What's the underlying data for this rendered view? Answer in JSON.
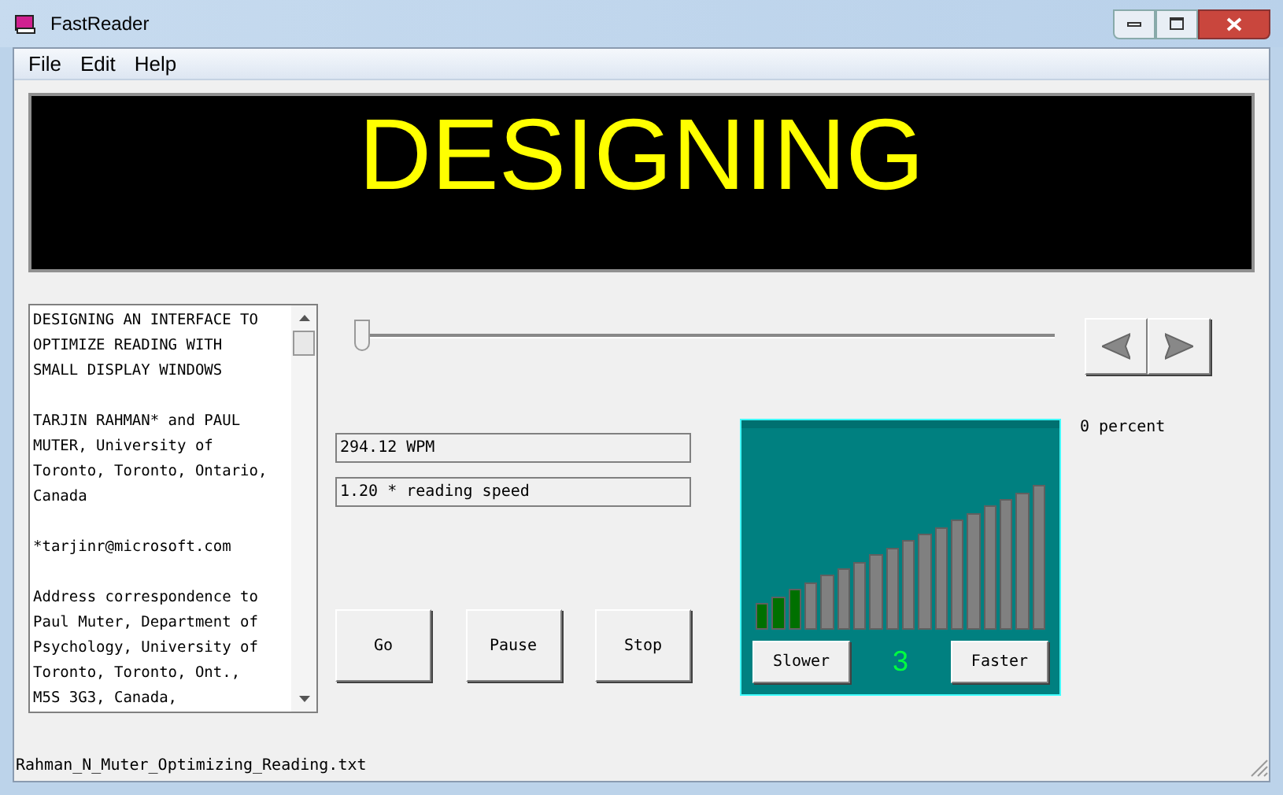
{
  "window": {
    "title": "FastReader"
  },
  "menu": [
    "File",
    "Edit",
    "Help"
  ],
  "display": {
    "word": "DESIGNING"
  },
  "document": {
    "paragraphs": [
      [
        "DESIGNING AN INTERFACE TO",
        "OPTIMIZE READING WITH",
        "SMALL DISPLAY WINDOWS"
      ],
      [
        "TARJIN RAHMAN* and PAUL",
        "MUTER, University of",
        "Toronto, Toronto, Ontario,",
        "Canada"
      ],
      [
        "*tarjinr@microsoft.com"
      ],
      [
        "Address correspondence to",
        "Paul Muter, Department of",
        "Psychology, University of",
        "Toronto, Toronto, Ont.,",
        "M5S 3G3, Canada,"
      ]
    ]
  },
  "position_slider": {
    "level": 0
  },
  "progress": {
    "reading": "0 percent"
  },
  "fields": [
    "294.12 WPM",
    "1.20 * reading speed"
  ],
  "buttons": [
    "Go",
    "Pause",
    "Stop"
  ],
  "speed_meter": {
    "bars": [
      {
        "filled": true
      },
      {
        "filled": true
      },
      {
        "filled": true
      },
      {
        "filled": false
      },
      {
        "filled": false
      },
      {
        "filled": false
      },
      {
        "filled": false
      },
      {
        "filled": false
      },
      {
        "filled": false
      },
      {
        "filled": false
      },
      {
        "filled": false
      },
      {
        "filled": false
      },
      {
        "filled": false
      },
      {
        "filled": false
      },
      {
        "filled": false
      },
      {
        "filled": false
      },
      {
        "filled": false
      },
      {
        "filled": false
      }
    ],
    "reading": "3",
    "slower": "Slower",
    "faster": "Faster"
  },
  "status_bar": {
    "file": "Rahman_N_Muter_Optimizing_Reading.txt"
  }
}
